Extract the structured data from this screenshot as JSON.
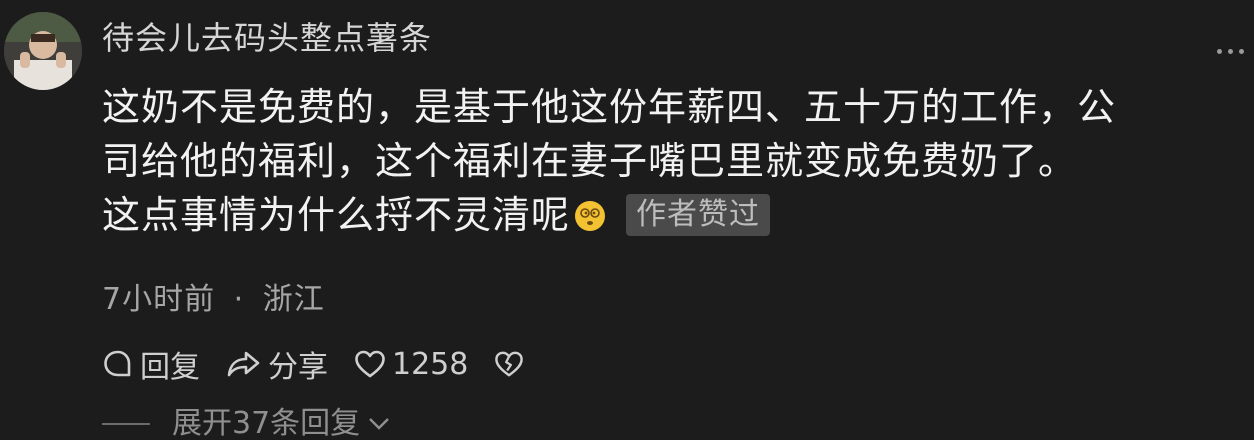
{
  "comment": {
    "username": "待会儿去码头整点薯条",
    "text_line1": "这奶不是免费的，是基于他这份年薪四、五十万的工作，公",
    "text_line2": "司给他的福利，这个福利在妻子嘴巴里就变成免费奶了。",
    "text_line3": "这点事情为什么捋不灵清呢",
    "author_liked_badge": "作者赞过",
    "time": "7小时前",
    "separator": "·",
    "location": "浙江",
    "reply_label": "回复",
    "share_label": "分享",
    "like_count": "1258",
    "expand_replies_label": "展开37条回复"
  },
  "icons": {
    "avatar": "avatar",
    "more": "more-dots-icon",
    "emoji": "dizzy-face-emoji-icon",
    "reply": "chat-bubble-icon",
    "share": "share-arrow-icon",
    "like": "heart-icon",
    "dislike": "broken-heart-icon",
    "expand": "chevron-down-icon"
  },
  "colors": {
    "background": "#1d1c1c",
    "text_primary": "#f2f2f2",
    "text_secondary": "#a6a6a6",
    "badge_bg": "#4a4a4a"
  }
}
